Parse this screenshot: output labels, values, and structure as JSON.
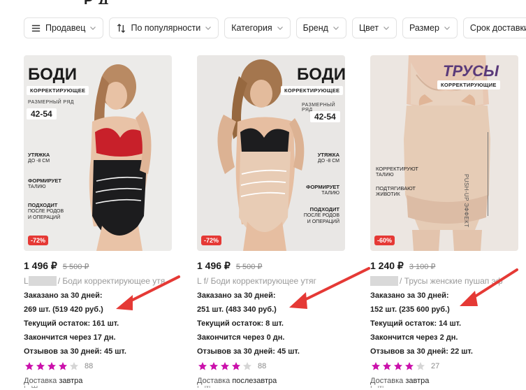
{
  "filters": [
    {
      "label": "Продавец",
      "icon": "menu-icon"
    },
    {
      "label": "По популярности",
      "icon": "sort-icon"
    },
    {
      "label": "Категория"
    },
    {
      "label": "Бренд"
    },
    {
      "label": "Цвет"
    },
    {
      "label": "Размер"
    },
    {
      "label": "Срок доставки"
    }
  ],
  "top_cut_text": "Р               Д",
  "products": [
    {
      "photo": {
        "title": "БОДИ",
        "strip": "КОРРЕКТИРУЮЩЕЕ",
        "size_caption": "РАЗМЕРНЫЙ РЯД",
        "size_range": "42-54",
        "feat1": "УТЯЖКА",
        "feat1_sub": "ДО -8 СМ",
        "feat2": "ФОРМИРУЕТ",
        "feat2_sub": "ТАЛИЮ",
        "feat3": "ПОДХОДИТ",
        "feat3_sub": "ПОСЛЕ РОДОВ",
        "feat3_sub2": "И ОПЕРАЦИЙ",
        "discount": "-72%"
      },
      "price": "1 496 ₽",
      "old_price": "5 500 ₽",
      "seller_prefix": "L",
      "name": "/ Боди корректирующее утя",
      "ordered_label": "Заказано за 30 дней:",
      "ordered_value": "269 шт. (519 420 руб.)",
      "stock": "Текущий остаток: 161 шт.",
      "ends": "Закончится через 17 дн.",
      "reviews": "Отзывов за 30 дней: 45 шт.",
      "rating": 4,
      "rating_count": "88",
      "delivery_label": "Доставка",
      "delivery_value": "завтра",
      "next_line": "Р       Ш"
    },
    {
      "photo": {
        "title": "БОДИ",
        "strip": "КОРРЕКТИРУЮЩЕЕ",
        "size_caption": "РАЗМЕРНЫЙ РЯД",
        "size_range": "42-54",
        "feat1": "УТЯЖКА",
        "feat1_sub": "ДО -8 СМ",
        "feat2": "ФОРМИРУЕТ",
        "feat2_sub": "ТАЛИЮ",
        "feat3": "ПОДХОДИТ",
        "feat3_sub": "ПОСЛЕ РОДОВ",
        "feat3_sub2": "И ОПЕРАЦИЙ",
        "discount": "-72%"
      },
      "price": "1 496 ₽",
      "old_price": "5 500 ₽",
      "seller_prefix": "L     f    ",
      "name": "/ Боди корректирующее утяг",
      "ordered_label": "Заказано за 30 дней:",
      "ordered_value": "251 шт. (483 340 руб.)",
      "stock": "Текущий остаток: 8 шт.",
      "ends": "Закончится через 0 дн.",
      "reviews": "Отзывов за 30 дней: 45 шт.",
      "rating": 4,
      "rating_count": "88",
      "delivery_label": "Доставка",
      "delivery_value": "послезавтра",
      "next_line": "Р       М"
    },
    {
      "photo": {
        "title": "ТРУСЫ",
        "strip": "КОРРЕКТИРУЮЩИЕ",
        "feat1": "КОРРЕКТИРУЮТ",
        "feat1_sub": "ТАЛИЮ",
        "feat2": "ПОДТЯГИВАЮТ",
        "feat2_sub": "ЖИВОТИК",
        "vertical": "PUSH-UP ЭФФЕКТ",
        "discount": "-60%"
      },
      "price": "1 240 ₽",
      "old_price": "3 100 ₽",
      "seller_prefix": "",
      "name": "/ Трусы женские пушап эф",
      "ordered_label": "Заказано за 30 дней:",
      "ordered_value": "152 шт. (235 600 руб.)",
      "stock": "Текущий остаток: 14 шт.",
      "ends": "Закончится через 2 дн.",
      "reviews": "Отзывов за 30 дней: 22 шт.",
      "rating": 4,
      "rating_count": "27",
      "delivery_label": "Доставка",
      "delivery_value": "завтра",
      "next_line": "Р       М"
    }
  ],
  "colors": {
    "accent_star": "#cb11ab",
    "arrow": "#e53935",
    "discount": "#e53935"
  }
}
